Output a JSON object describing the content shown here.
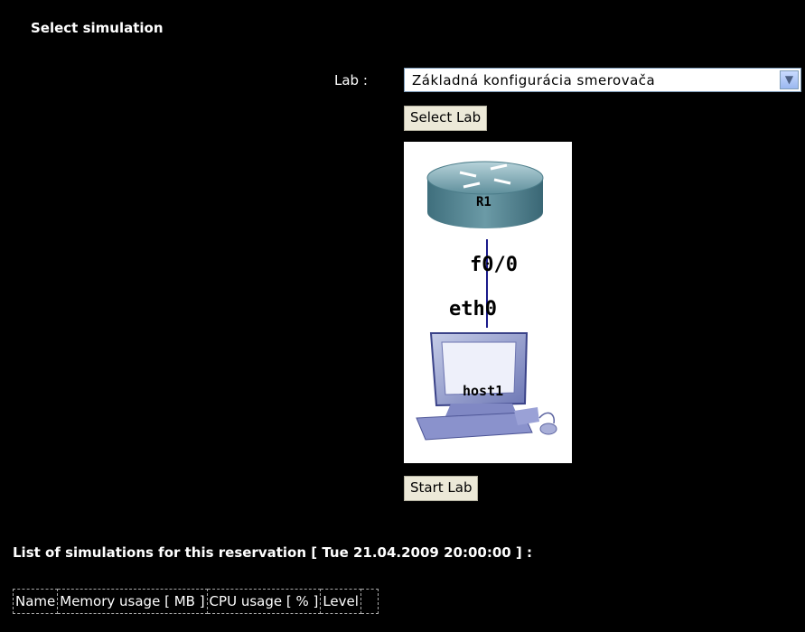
{
  "section": {
    "title": "Select simulation"
  },
  "lab_selector": {
    "label": "Lab :",
    "selected": "Základná konfigurácia smerovača",
    "select_button": "Select Lab"
  },
  "topology": {
    "router_name": "R1",
    "router_interface": "f0/0",
    "host_interface": "eth0",
    "host_name": "host1"
  },
  "start_button": "Start Lab",
  "simulations": {
    "title": "List of simulations for this reservation [ Tue 21.04.2009 20:00:00 ] :",
    "columns": [
      "Name",
      "Memory usage [ MB ]",
      "CPU usage [ % ]",
      "Level"
    ]
  }
}
